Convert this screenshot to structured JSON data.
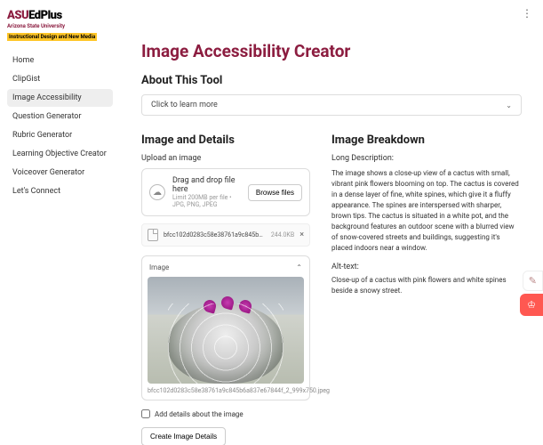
{
  "logo": {
    "brand1": "ASU",
    "brand2": "EdPlus",
    "subtitle": "Arizona State University",
    "tagline": "Instructional Design and New Media"
  },
  "nav": {
    "items": [
      {
        "label": "Home"
      },
      {
        "label": "ClipGist"
      },
      {
        "label": "Image Accessibility"
      },
      {
        "label": "Question Generator"
      },
      {
        "label": "Rubric Generator"
      },
      {
        "label": "Learning Objective Creator"
      },
      {
        "label": "Voiceover Generator"
      },
      {
        "label": "Let's Connect"
      }
    ],
    "active_index": 2
  },
  "page": {
    "title": "Image Accessibility Creator",
    "about_heading": "About This Tool",
    "accordion_label": "Click to learn more"
  },
  "left": {
    "heading": "Image and Details",
    "upload_label": "Upload an image",
    "dropzone_main": "Drag and drop file here",
    "dropzone_sub": "Limit 200MB per file • JPG, PNG, JPEG",
    "browse_label": "Browse files",
    "file_name": "bfcc102d0283c58e38761a9c845b0a837e...",
    "file_size": "244.0KB",
    "preview_label": "Image",
    "preview_filename": "bfcc102d0283c58e38761a9c845b6a837e67844f_2_999x750.jpeg",
    "checkbox_label": "Add details about the image",
    "create_button": "Create Image Details"
  },
  "right": {
    "heading": "Image Breakdown",
    "long_desc_label": "Long Description:",
    "long_desc": "The image shows a close-up view of a cactus with small, vibrant pink flowers blooming on top. The cactus is covered in a dense layer of fine, white spines, which give it a fluffy appearance. The spines are interspersed with sharper, brown tips. The cactus is situated in a white pot, and the background features an outdoor scene with a blurred view of snow-covered streets and buildings, suggesting it's placed indoors near a window.",
    "alt_label": "Alt-text:",
    "alt_text": "Close-up of a cactus with pink flowers and white spines beside a snowy street."
  },
  "badges": {
    "crown": "♔",
    "edit": "✎"
  }
}
